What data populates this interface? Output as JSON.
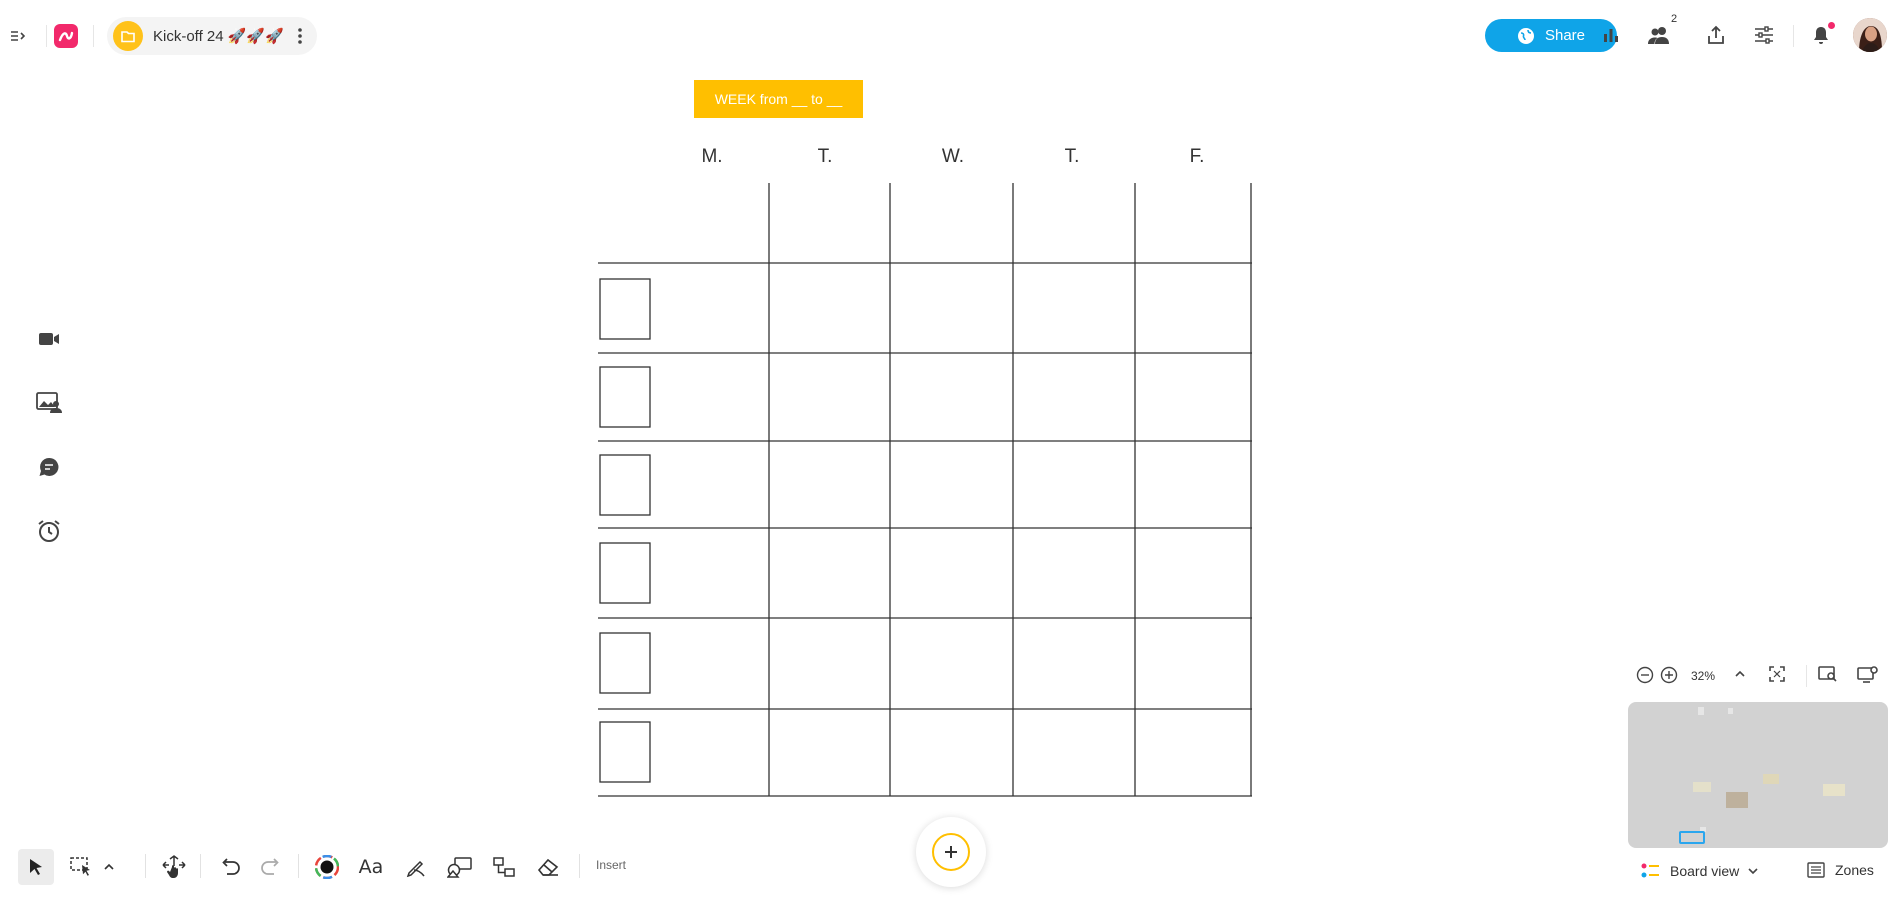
{
  "header": {
    "board_title": "Kick-off 24 🚀🚀🚀",
    "share_label": "Share",
    "participants_count": "2"
  },
  "sidebar": {
    "icons": [
      "video-camera-icon",
      "image-person-icon",
      "chat-bubble-icon",
      "timer-icon"
    ]
  },
  "board": {
    "week_banner": "WEEK from __ to __",
    "days": [
      "M.",
      "T.",
      "W.",
      "T.",
      "F."
    ],
    "banner_color": "#ffbf00"
  },
  "zoom": {
    "level": "32%"
  },
  "footer": {
    "board_view_label": "Board view",
    "zones_label": "Zones",
    "insert_label": "Insert"
  },
  "colors": {
    "brand": "#f2296b",
    "share": "#0fa4e8",
    "accent": "#ffbf00"
  }
}
